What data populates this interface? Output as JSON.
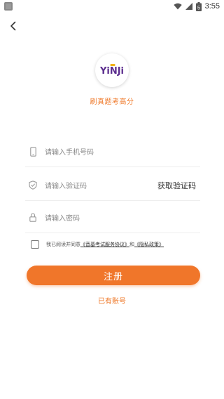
{
  "status_bar": {
    "time": "3:55",
    "battery_level": "5",
    "icons": [
      "notification-icon",
      "wifi-icon",
      "signal-icon",
      "battery-icon"
    ]
  },
  "header": {
    "back_icon": "chevron-left-icon"
  },
  "brand": {
    "logo_text": "YiNJi",
    "slogan": "刷真题考高分"
  },
  "form": {
    "phone": {
      "placeholder": "请输入手机号码",
      "icon": "phone-icon"
    },
    "code": {
      "placeholder": "请输入验证码",
      "icon": "shield-icon",
      "action": "获取验证码"
    },
    "password": {
      "placeholder": "请输入密码",
      "icon": "lock-icon"
    }
  },
  "agreement": {
    "prefix": "我已阅读并同意",
    "terms": "《音基考试服务协议》",
    "and": "和",
    "privacy": "《隐私政策》",
    "checked": false
  },
  "actions": {
    "register": "注册",
    "has_account": "已有账号"
  },
  "colors": {
    "accent": "#f0762a",
    "logo_purple": "#5b2d8e",
    "logo_gold": "#f2b318"
  }
}
